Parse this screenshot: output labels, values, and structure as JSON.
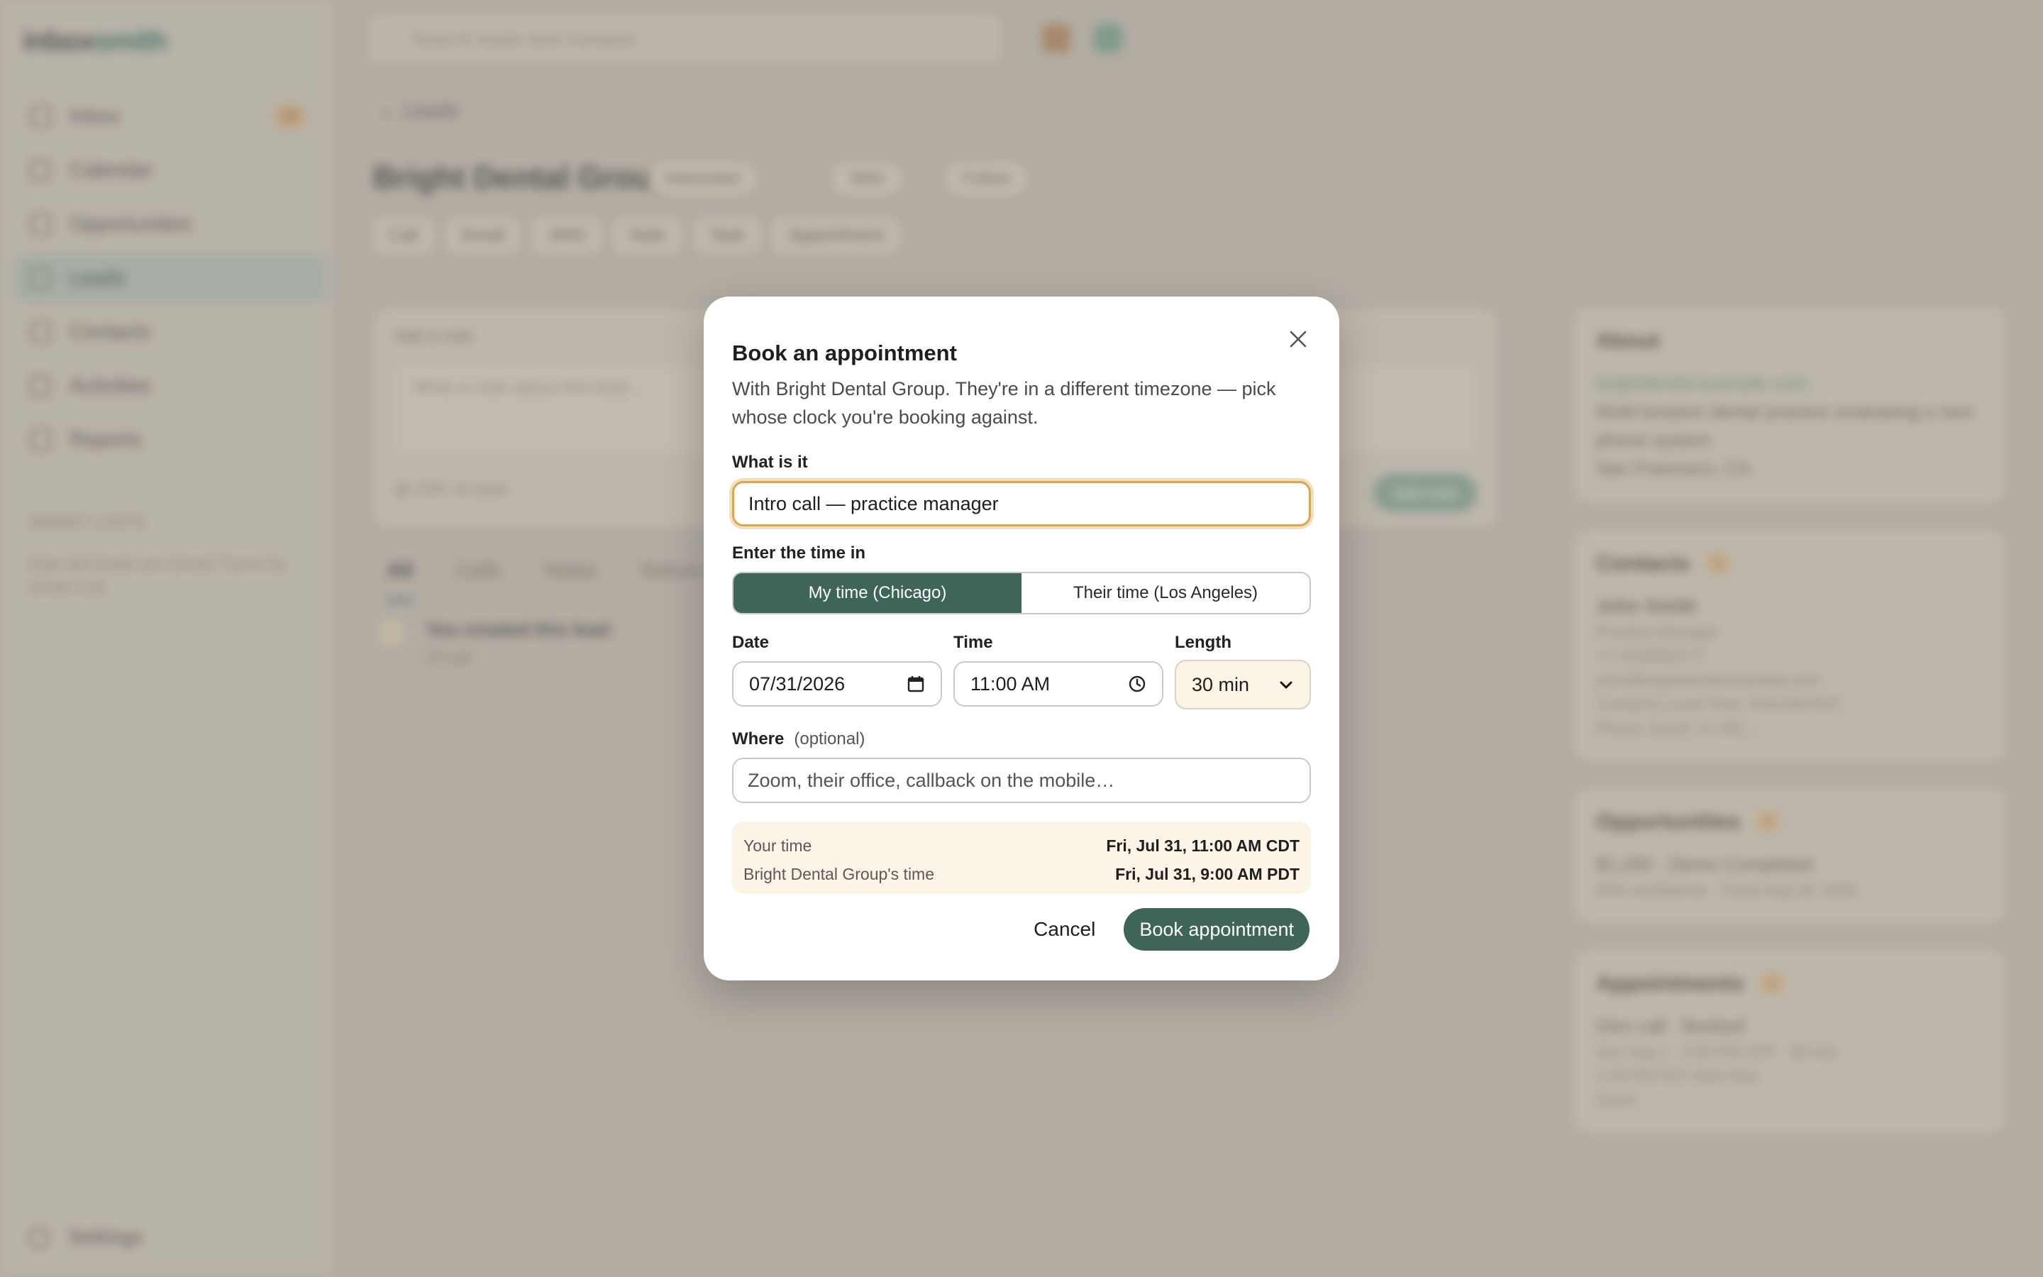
{
  "colors": {
    "accent": "#3f6459",
    "focus_ring": "#e0a44a",
    "summary_bg": "#fdf4e8",
    "backdrop": "#b8b3ab"
  },
  "background": {
    "logo": {
      "main": "inbox",
      "accent": "smith"
    },
    "nav": [
      {
        "label": "Inbox",
        "icon": "inbox-icon",
        "badge": "25"
      },
      {
        "label": "Calendar",
        "icon": "calendar-icon"
      },
      {
        "label": "Opportunities",
        "icon": "briefcase-icon"
      },
      {
        "label": "Leads",
        "icon": "user-icon",
        "active": true
      },
      {
        "label": "Contacts",
        "icon": "contacts-icon"
      },
      {
        "label": "Activities",
        "icon": "activity-icon"
      },
      {
        "label": "Reports",
        "icon": "chart-icon"
      }
    ],
    "smart_lists": {
      "title": "SMART LISTS",
      "description": "Pipe dot leads are Smart Turns by Smart List"
    },
    "settings_label": "Settings",
    "search_placeholder": "Search leads and contacts",
    "back_label": "Leads",
    "lead": {
      "name": "Bright Dental Group",
      "status": "Interested",
      "phone_chip": "SMS",
      "extra_chip": "Follow"
    },
    "actions": [
      "Call",
      "Email",
      "SMS",
      "Note",
      "Task",
      "Appointment"
    ],
    "note": {
      "label": "Add a note",
      "placeholder": "Write a note about this lead...",
      "meta": "@ Ctrl+ to save",
      "button": "Add note"
    },
    "filters": [
      "All",
      "Calls",
      "Notes",
      "Status changes"
    ],
    "activity": {
      "title": "You created this lead",
      "time": "2d ago"
    },
    "about": {
      "title": "About",
      "website": "brightdental.example.com",
      "description": "Multi-location dental practice evaluating a new phone system",
      "location": "San Francisco, CA"
    },
    "contacts": {
      "title": "Contacts",
      "count": "1",
      "name": "John Smith",
      "role": "Practice Manager",
      "phone": "+1 4155550177",
      "email": "john@brightdental.example.com",
      "local_time": "Contact's Local Time: 9:00 AM PDT",
      "input_placeholder": "Phone, Email, or URL..."
    },
    "opportunities": {
      "title": "Opportunities",
      "count": "1",
      "value": "$1,200",
      "status": "Demo Completed",
      "details": "40% confidence · Close Aug 20, 2026"
    },
    "appointments": {
      "title": "Appointments",
      "count": "1",
      "name": "Intro call",
      "state": "Booked",
      "when": "Sat, Aug 1 · 3:30 PM CDT · 30 min",
      "local": "1:30 PM PDT their time",
      "where": "Zoom"
    }
  },
  "modal": {
    "title": "Book an appointment",
    "subtitle": "With Bright Dental Group. They're in a different timezone — pick whose clock you're booking against.",
    "what_label": "What is it",
    "what_value": "Intro call — practice manager",
    "tz_label": "Enter the time in",
    "tz_options": [
      "My time (Chicago)",
      "Their time (Los Angeles)"
    ],
    "date_label": "Date",
    "date_value": "07/31/2026",
    "time_label": "Time",
    "time_value": "11:00 AM",
    "length_label": "Length",
    "length_value": "30 min",
    "where_label": "Where",
    "where_optional": "(optional)",
    "where_placeholder": "Zoom, their office, callback on the mobile…",
    "summary": {
      "your_label": "Your time",
      "your_value": "Fri, Jul 31, 11:00 AM CDT",
      "their_label": "Bright Dental Group's time",
      "their_value": "Fri, Jul 31, 9:00 AM PDT"
    },
    "cancel_label": "Cancel",
    "book_label": "Book appointment"
  }
}
